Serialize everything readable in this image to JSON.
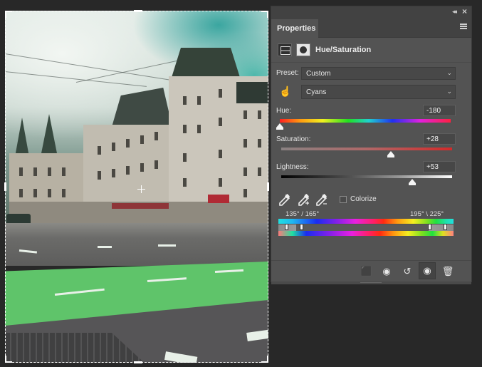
{
  "panel": {
    "tab_label": "Properties",
    "adjustment_title": "Hue/Saturation",
    "collapse_icon": "double-chevron-right-icon",
    "close_icon": "close-icon",
    "menu_icon": "hamburger-menu-icon"
  },
  "preset": {
    "label": "Preset:",
    "value": "Custom"
  },
  "channel": {
    "value": "Cyans",
    "targeted_adjust_icon": "hand-pointer-icon"
  },
  "hue": {
    "label": "Hue:",
    "value": "-180",
    "fraction": 0.0
  },
  "saturation": {
    "label": "Saturation:",
    "value": "+28",
    "fraction": 0.64
  },
  "lightness": {
    "label": "Lightness:",
    "value": "+53",
    "fraction": 0.765
  },
  "tools": {
    "eyedropper": "eyedropper-icon",
    "eyedropper_add": "eyedropper-plus-icon",
    "eyedropper_subtract": "eyedropper-minus-icon",
    "colorize_label": "Colorize",
    "colorize_checked": false
  },
  "range": {
    "left_label": "135° /  165°",
    "right_label": "195° \\  225°"
  },
  "footer": {
    "clip_to_layer": "clip-to-layer-icon",
    "view_previous": "view-previous-state-icon",
    "reset": "reset-icon",
    "visibility": "eye-icon",
    "delete": "trash-icon"
  },
  "colors": {
    "panel_bg": "#535353",
    "app_bg": "#282828",
    "saturation_end": "#d42a2a",
    "green_lane": "#5fc46a"
  }
}
